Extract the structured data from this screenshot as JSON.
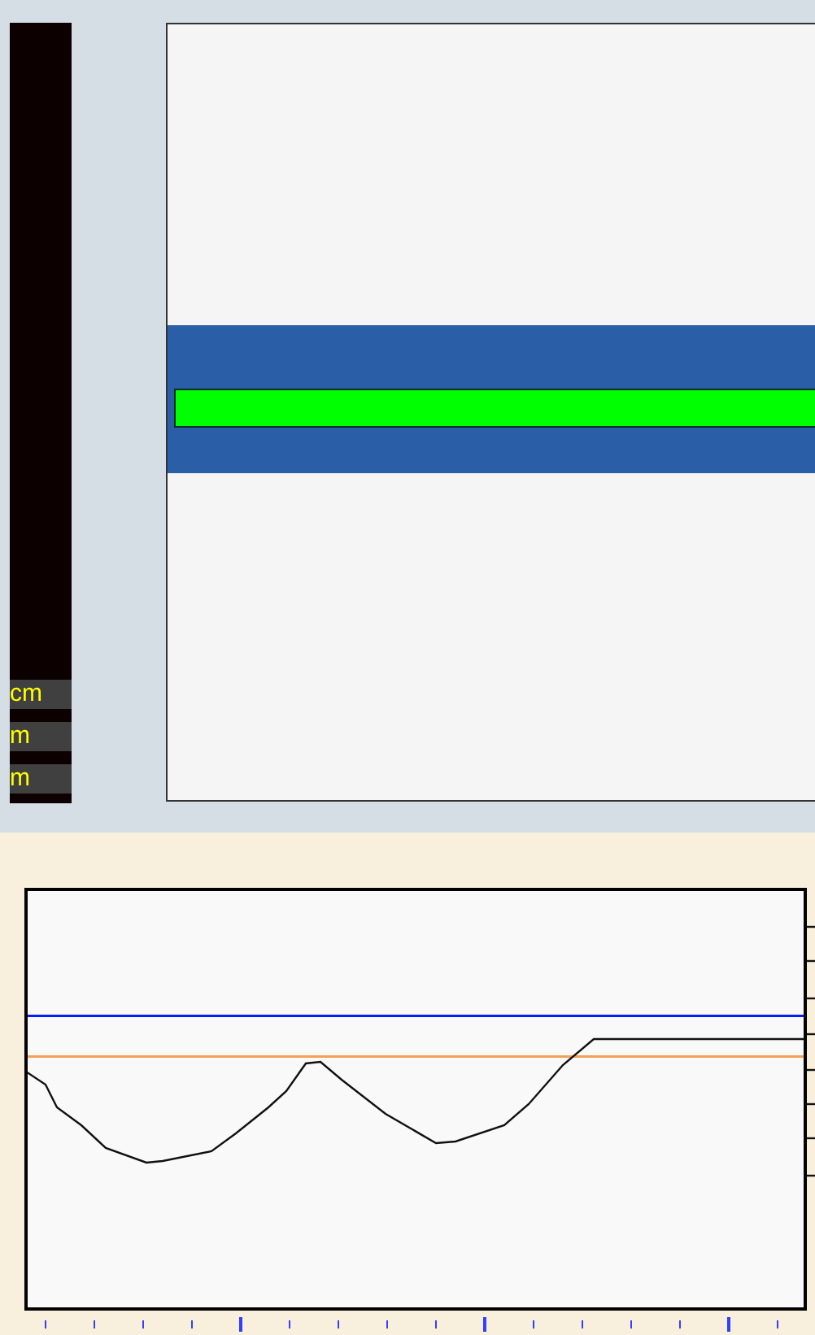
{
  "units": [
    {
      "text": "cm"
    },
    {
      "text": "m"
    },
    {
      "text": "m"
    }
  ]
}
